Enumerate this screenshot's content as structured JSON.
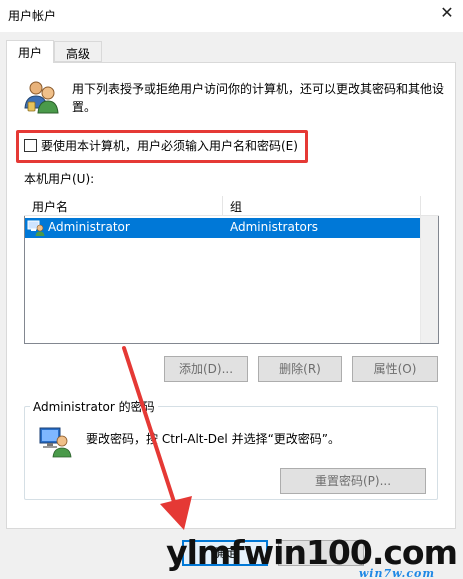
{
  "window": {
    "title": "用户帐户",
    "close_glyph": "✕"
  },
  "tabs": [
    {
      "label": "用户",
      "active": true
    },
    {
      "label": "高级",
      "active": false
    }
  ],
  "description": "用下列表授予或拒绝用户访问你的计算机，还可以更改其密码和其他设置。",
  "require_login": {
    "label": "要使用本计算机，用户必须输入用户名和密码(E)",
    "checked": false,
    "highlight_color": "#e53935"
  },
  "local_users_label": "本机用户(U):",
  "users_table": {
    "columns": [
      "用户名",
      "组"
    ],
    "rows": [
      {
        "username": "Administrator",
        "group": "Administrators",
        "selected": true
      }
    ]
  },
  "user_buttons": {
    "add": "添加(D)...",
    "remove": "删除(R)",
    "properties": "属性(O)"
  },
  "password_group": {
    "title": "Administrator 的密码",
    "description": "要改密码，按 Ctrl-Alt-Del 并选择“更改密码”。",
    "reset_button": "重置密码(P)..."
  },
  "dialog_buttons": {
    "ok": "确定"
  },
  "watermark": {
    "main": "ylmfwin100.com",
    "sub": "win7w.com"
  },
  "colors": {
    "selection": "#0078d7",
    "annotation_red": "#e53935"
  }
}
